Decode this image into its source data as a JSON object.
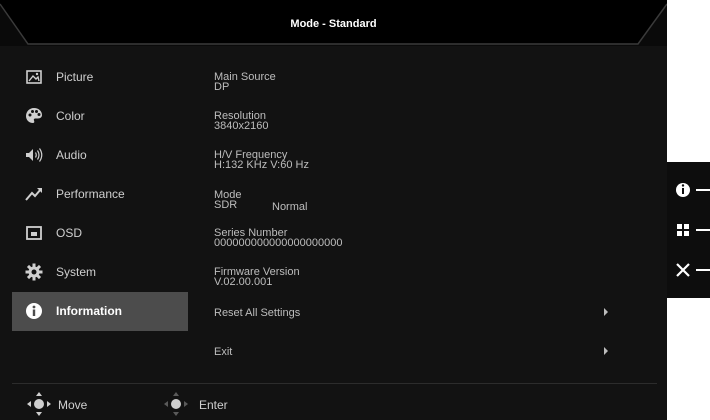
{
  "header": {
    "title": "Mode - Standard"
  },
  "nav": {
    "items": [
      {
        "label": "Picture",
        "icon": "picture-icon"
      },
      {
        "label": "Color",
        "icon": "palette-icon"
      },
      {
        "label": "Audio",
        "icon": "speaker-icon"
      },
      {
        "label": "Performance",
        "icon": "performance-icon"
      },
      {
        "label": "OSD",
        "icon": "osd-icon"
      },
      {
        "label": "System",
        "icon": "gear-icon"
      },
      {
        "label": "Information",
        "icon": "info-icon",
        "active": true
      }
    ]
  },
  "info": {
    "main_source": {
      "label": "Main Source",
      "value": "DP"
    },
    "resolution": {
      "label": "Resolution",
      "value": "3840x2160"
    },
    "frequency": {
      "label": "H/V Frequency",
      "value": "H:132 KHz V:60 Hz"
    },
    "mode": {
      "label": "Mode",
      "value": "SDR",
      "extra": "Normal"
    },
    "serial": {
      "label": "Series Number",
      "value": "000000000000000000000"
    },
    "firmware": {
      "label": "Firmware Version",
      "value": "V.02.00.001"
    }
  },
  "menu": {
    "reset": "Reset All Settings",
    "exit": "Exit"
  },
  "footer": {
    "move": "Move",
    "enter": "Enter"
  },
  "side_buttons": [
    {
      "icon": "info-icon"
    },
    {
      "icon": "grid-icon"
    },
    {
      "icon": "close-icon"
    }
  ],
  "colors": {
    "background": "#121212",
    "active_item": "#4c4c4c",
    "text": "#cfcfcf"
  }
}
